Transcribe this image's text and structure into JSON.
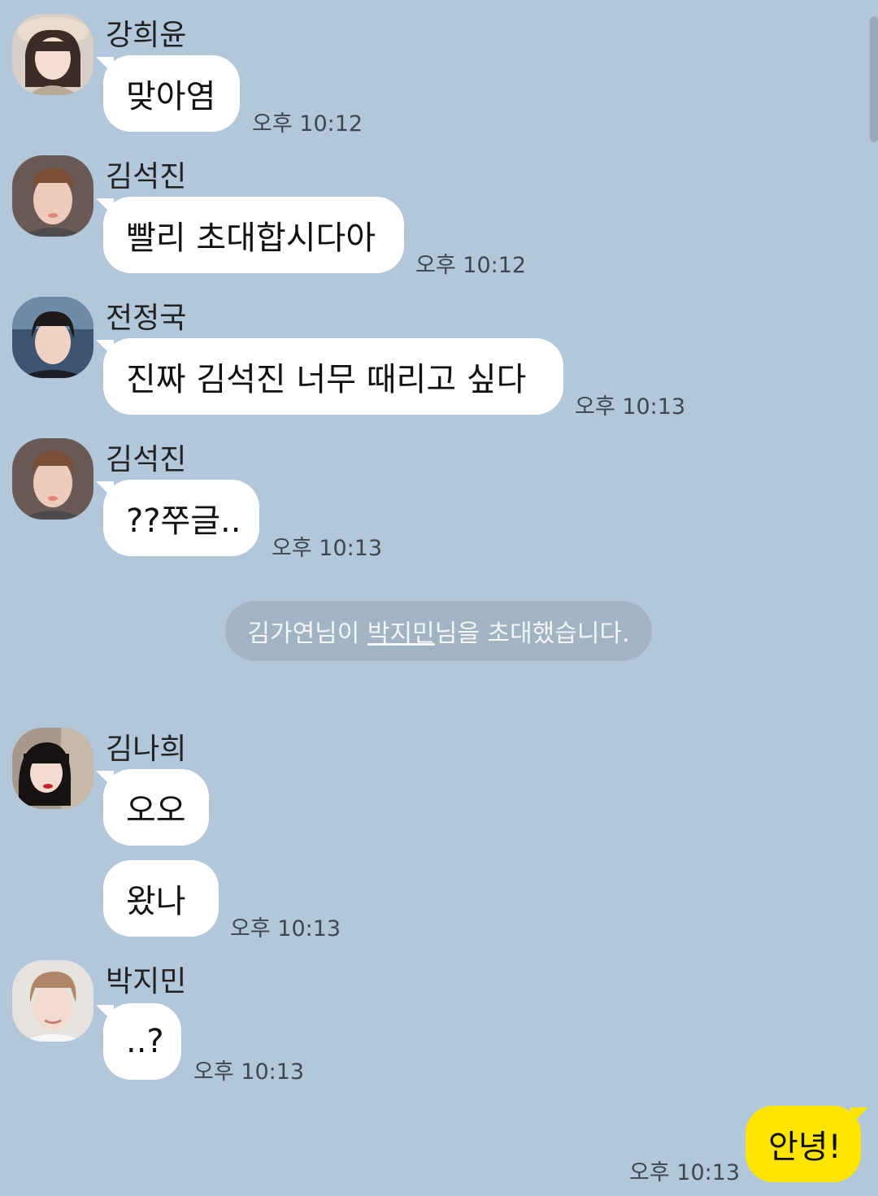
{
  "chat": {
    "groups": [
      {
        "sender": "강희윤",
        "avatar_icon": "profile-photo-girl-long-hair",
        "messages": [
          {
            "text": "맞아염"
          }
        ],
        "time": "오후 10:12"
      },
      {
        "sender": "김석진",
        "avatar_icon": "profile-photo-man",
        "messages": [
          {
            "text": "빨리 초대합시다아"
          }
        ],
        "time": "오후 10:12"
      },
      {
        "sender": "전정국",
        "avatar_icon": "profile-photo-man-dark-hair",
        "messages": [
          {
            "text": "진짜 김석진 너무 때리고 싶다"
          }
        ],
        "time": "오후 10:13"
      },
      {
        "sender": "김석진",
        "avatar_icon": "profile-photo-man",
        "messages": [
          {
            "text": "??쭈글.."
          }
        ],
        "time": "오후 10:13"
      },
      {
        "sender": "김나희",
        "avatar_icon": "profile-photo-girl-bob-hair",
        "messages": [
          {
            "text": "오오"
          },
          {
            "text": "왔나"
          }
        ],
        "time": "오후 10:13"
      },
      {
        "sender": "박지민",
        "avatar_icon": "profile-photo-man-light-hair",
        "messages": [
          {
            "text": "..?"
          }
        ],
        "time": "오후 10:13"
      }
    ],
    "system_notice": {
      "prefix": "김가연님이 ",
      "invitee": "박지민",
      "suffix": "님을 초대했습니다."
    },
    "my_message": {
      "text": "안녕!",
      "time": "오후 10:13"
    }
  },
  "colors": {
    "background": "#b2c7da",
    "incoming_bubble": "#ffffff",
    "outgoing_bubble": "#fee500",
    "system_notice_bg": "#a2b3c3"
  }
}
